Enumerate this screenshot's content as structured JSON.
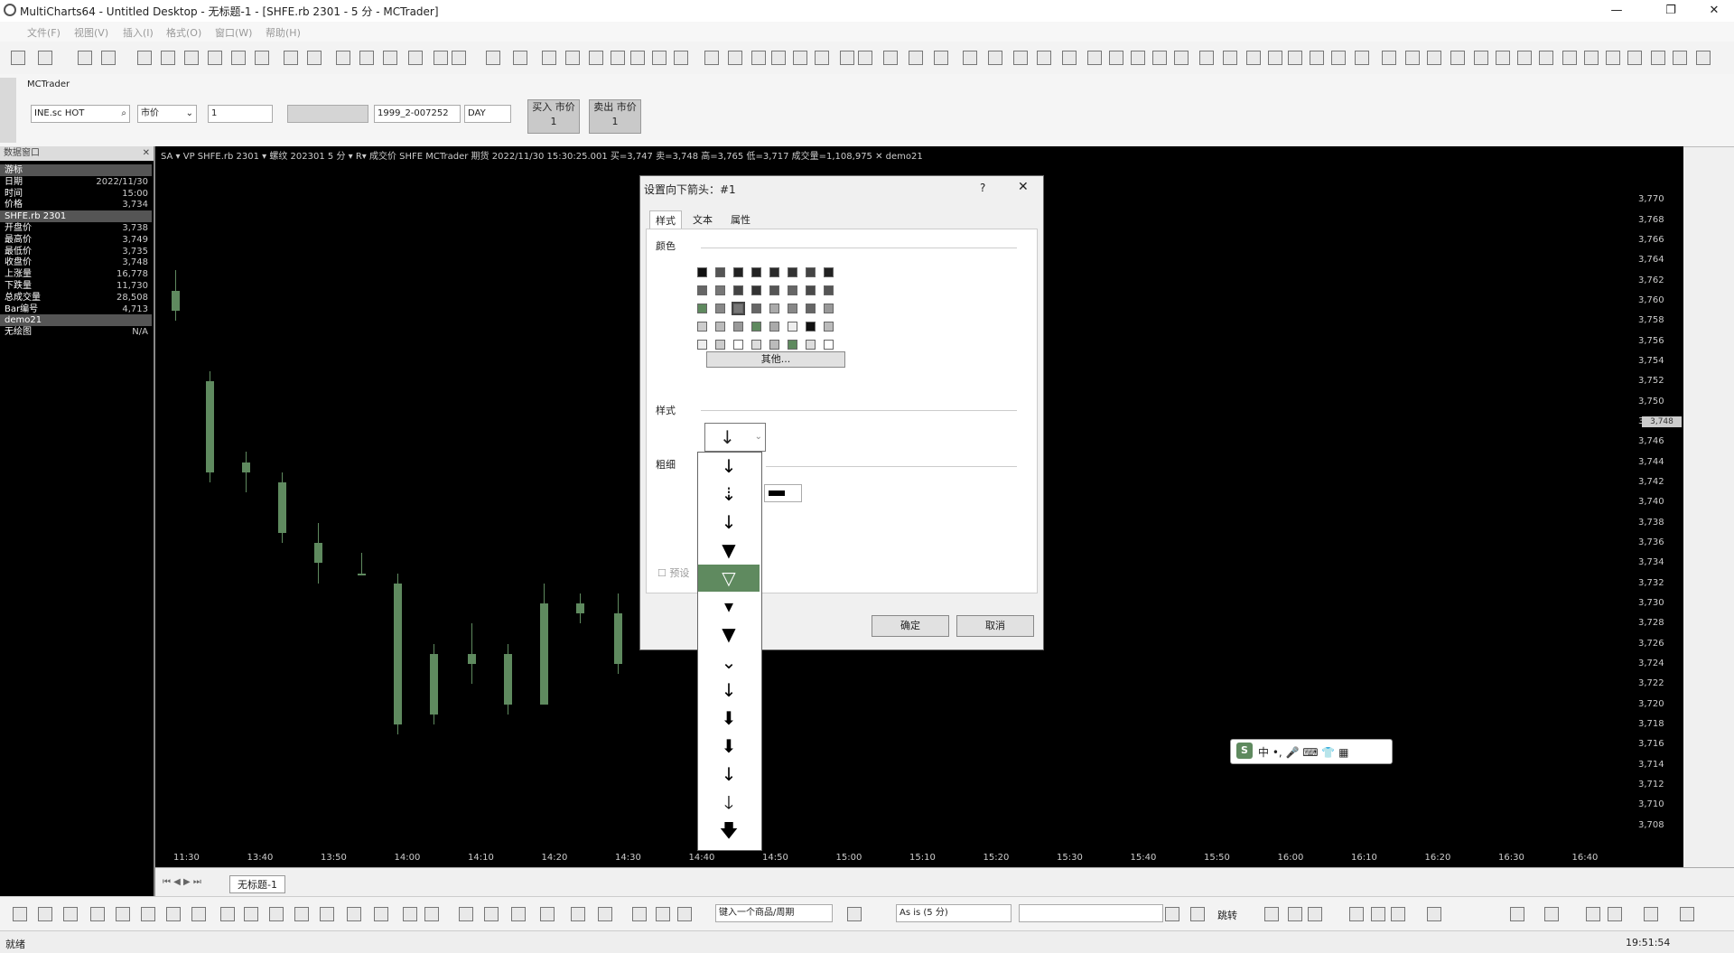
{
  "window": {
    "title": "MultiCharts64 - Untitled Desktop - 无标题-1 - [SHFE.rb 2301 - 5 分 - MCTrader]"
  },
  "menu": [
    "文件(F)",
    "视图(V)",
    "插入(I)",
    "格式(O)",
    "窗口(W)",
    "帮助(H)"
  ],
  "trade": {
    "tab": "MCTrader",
    "symbol": "INE.sc HOT",
    "order_type": "市价",
    "qty": "1",
    "account": "1999_2-007252",
    "tif": "DAY",
    "buy_label": "买入 市价",
    "buy_qty": "1",
    "sell_label": "卖出 市价",
    "sell_qty": "1"
  },
  "data_window": {
    "title": "数据窗口",
    "rows": [
      {
        "k": "游标",
        "v": "",
        "sec": true
      },
      {
        "k": "日期",
        "v": "2022/11/30"
      },
      {
        "k": "时间",
        "v": "15:00"
      },
      {
        "k": "价格",
        "v": "3,734"
      },
      {
        "k": "SHFE.rb 2301",
        "v": "",
        "sec": true
      },
      {
        "k": "开盘价",
        "v": "3,738"
      },
      {
        "k": "最高价",
        "v": "3,749"
      },
      {
        "k": "最低价",
        "v": "3,735"
      },
      {
        "k": "收盘价",
        "v": "3,748"
      },
      {
        "k": "上涨量",
        "v": "16,778"
      },
      {
        "k": "下跌量",
        "v": "11,730"
      },
      {
        "k": "总成交量",
        "v": "28,508"
      },
      {
        "k": "Bar编号",
        "v": "4,713"
      },
      {
        "k": "demo21",
        "v": "",
        "sec": true
      },
      {
        "k": "无绘图",
        "v": "N/A"
      }
    ]
  },
  "chart": {
    "statusline": "SA ▾  VP  SHFE.rb 2301  ▾  螺纹  202301  5 分  ▾  R▾  成交价  SHFE  MCTrader  期货  2022/11/30  15:30:25.001  买=3,747  卖=3,748  高=3,765  低=3,717  成交量=1,108,975  ✕  demo21",
    "price_ticks": [
      "3,770",
      "3,768",
      "3,766",
      "3,764",
      "3,762",
      "3,760",
      "3,758",
      "3,756",
      "3,754",
      "3,752",
      "3,750",
      "3,748",
      "3,746",
      "3,744",
      "3,742",
      "3,740",
      "3,738",
      "3,736",
      "3,734",
      "3,732",
      "3,730",
      "3,728",
      "3,726",
      "3,724",
      "3,722",
      "3,720",
      "3,718",
      "3,716",
      "3,714",
      "3,712",
      "3,710",
      "3,708"
    ],
    "time_ticks": [
      "11:30",
      "13:40",
      "13:50",
      "14:00",
      "14:10",
      "14:20",
      "14:30",
      "14:40",
      "14:50",
      "15:00",
      "15:10",
      "15:20",
      "15:30",
      "15:40",
      "15:50",
      "16:00",
      "16:10",
      "16:20",
      "16:30",
      "16:40"
    ],
    "current_price": "3,748",
    "candle_color": "#5f8a5f"
  },
  "chart_data": {
    "type": "bar",
    "title": "",
    "xlabel": "",
    "ylabel": "",
    "ylim": [
      3707,
      3771
    ],
    "candles": [
      {
        "o": 3759,
        "c": 3761,
        "h": 3763,
        "l": 3758
      },
      {
        "o": 3752,
        "c": 3743,
        "h": 3753,
        "l": 3742
      },
      {
        "o": 3744,
        "c": 3743,
        "h": 3745,
        "l": 3741
      },
      {
        "o": 3742,
        "c": 3737,
        "h": 3743,
        "l": 3736
      },
      {
        "o": 3736,
        "c": 3734,
        "h": 3738,
        "l": 3732
      },
      {
        "o": 3733,
        "c": 3733,
        "h": 3735,
        "l": 3733
      },
      {
        "o": 3732,
        "c": 3718,
        "h": 3733,
        "l": 3717
      },
      {
        "o": 3725,
        "c": 3719,
        "h": 3726,
        "l": 3718
      },
      {
        "o": 3725,
        "c": 3724,
        "h": 3728,
        "l": 3722
      },
      {
        "o": 3725,
        "c": 3720,
        "h": 3726,
        "l": 3719
      },
      {
        "o": 3730,
        "c": 3720,
        "h": 3732,
        "l": 3720
      },
      {
        "o": 3730,
        "c": 3729,
        "h": 3731,
        "l": 3728
      },
      {
        "o": 3729,
        "c": 3724,
        "h": 3731,
        "l": 3723
      }
    ]
  },
  "dialog": {
    "title": "设置向下箭头：#1",
    "help": "?",
    "tabs": [
      "样式",
      "文本",
      "属性"
    ],
    "color_label": "颜色",
    "other_button": "其他...",
    "style_label": "样式",
    "width_label": "粗细",
    "preset_label": "预设",
    "ok": "确定",
    "cancel": "取消",
    "selected_style": "↓",
    "swatches": [
      "#111111",
      "#555555",
      "#222222",
      "#222222",
      "#2a2a2a",
      "#333333",
      "#444444",
      "#222222",
      "#666666",
      "#777777",
      "#444444",
      "#333333",
      "#555555",
      "#666666",
      "#4a4a4a",
      "#555555",
      "#5f8a5f",
      "#888888",
      "#777777",
      "#666666",
      "#aaaaaa",
      "#888888",
      "#666666",
      "#999999",
      "#cccccc",
      "#bbbbbb",
      "#999999",
      "#5f8a5f",
      "#aaaaaa",
      "#eeeeee",
      "#111111",
      "#bbbbbb",
      "#eeeeee",
      "#cccccc",
      "#ffffff",
      "#dddddd",
      "#bbbbbb",
      "#5f8a5f",
      "#dddddd",
      "#ffffff"
    ]
  },
  "arrow_styles": [
    "↓",
    "⇣",
    "↓",
    "▼",
    "▽",
    "▾",
    "▼",
    "⌄",
    "↓",
    "⬇",
    "⬇",
    "↓",
    "🡓",
    "🡇"
  ],
  "arrow_selected_index": 4,
  "bottom": {
    "sheet_tab": "无标题-1",
    "symbol_input": "键入一个商品/周期",
    "resolution": "As is (5 分)",
    "jump": "跳转",
    "status": "就绪",
    "clock": "19:51:54"
  },
  "ime": {
    "text": "中 •, 🎤 ⌨ 👕 ▦"
  }
}
